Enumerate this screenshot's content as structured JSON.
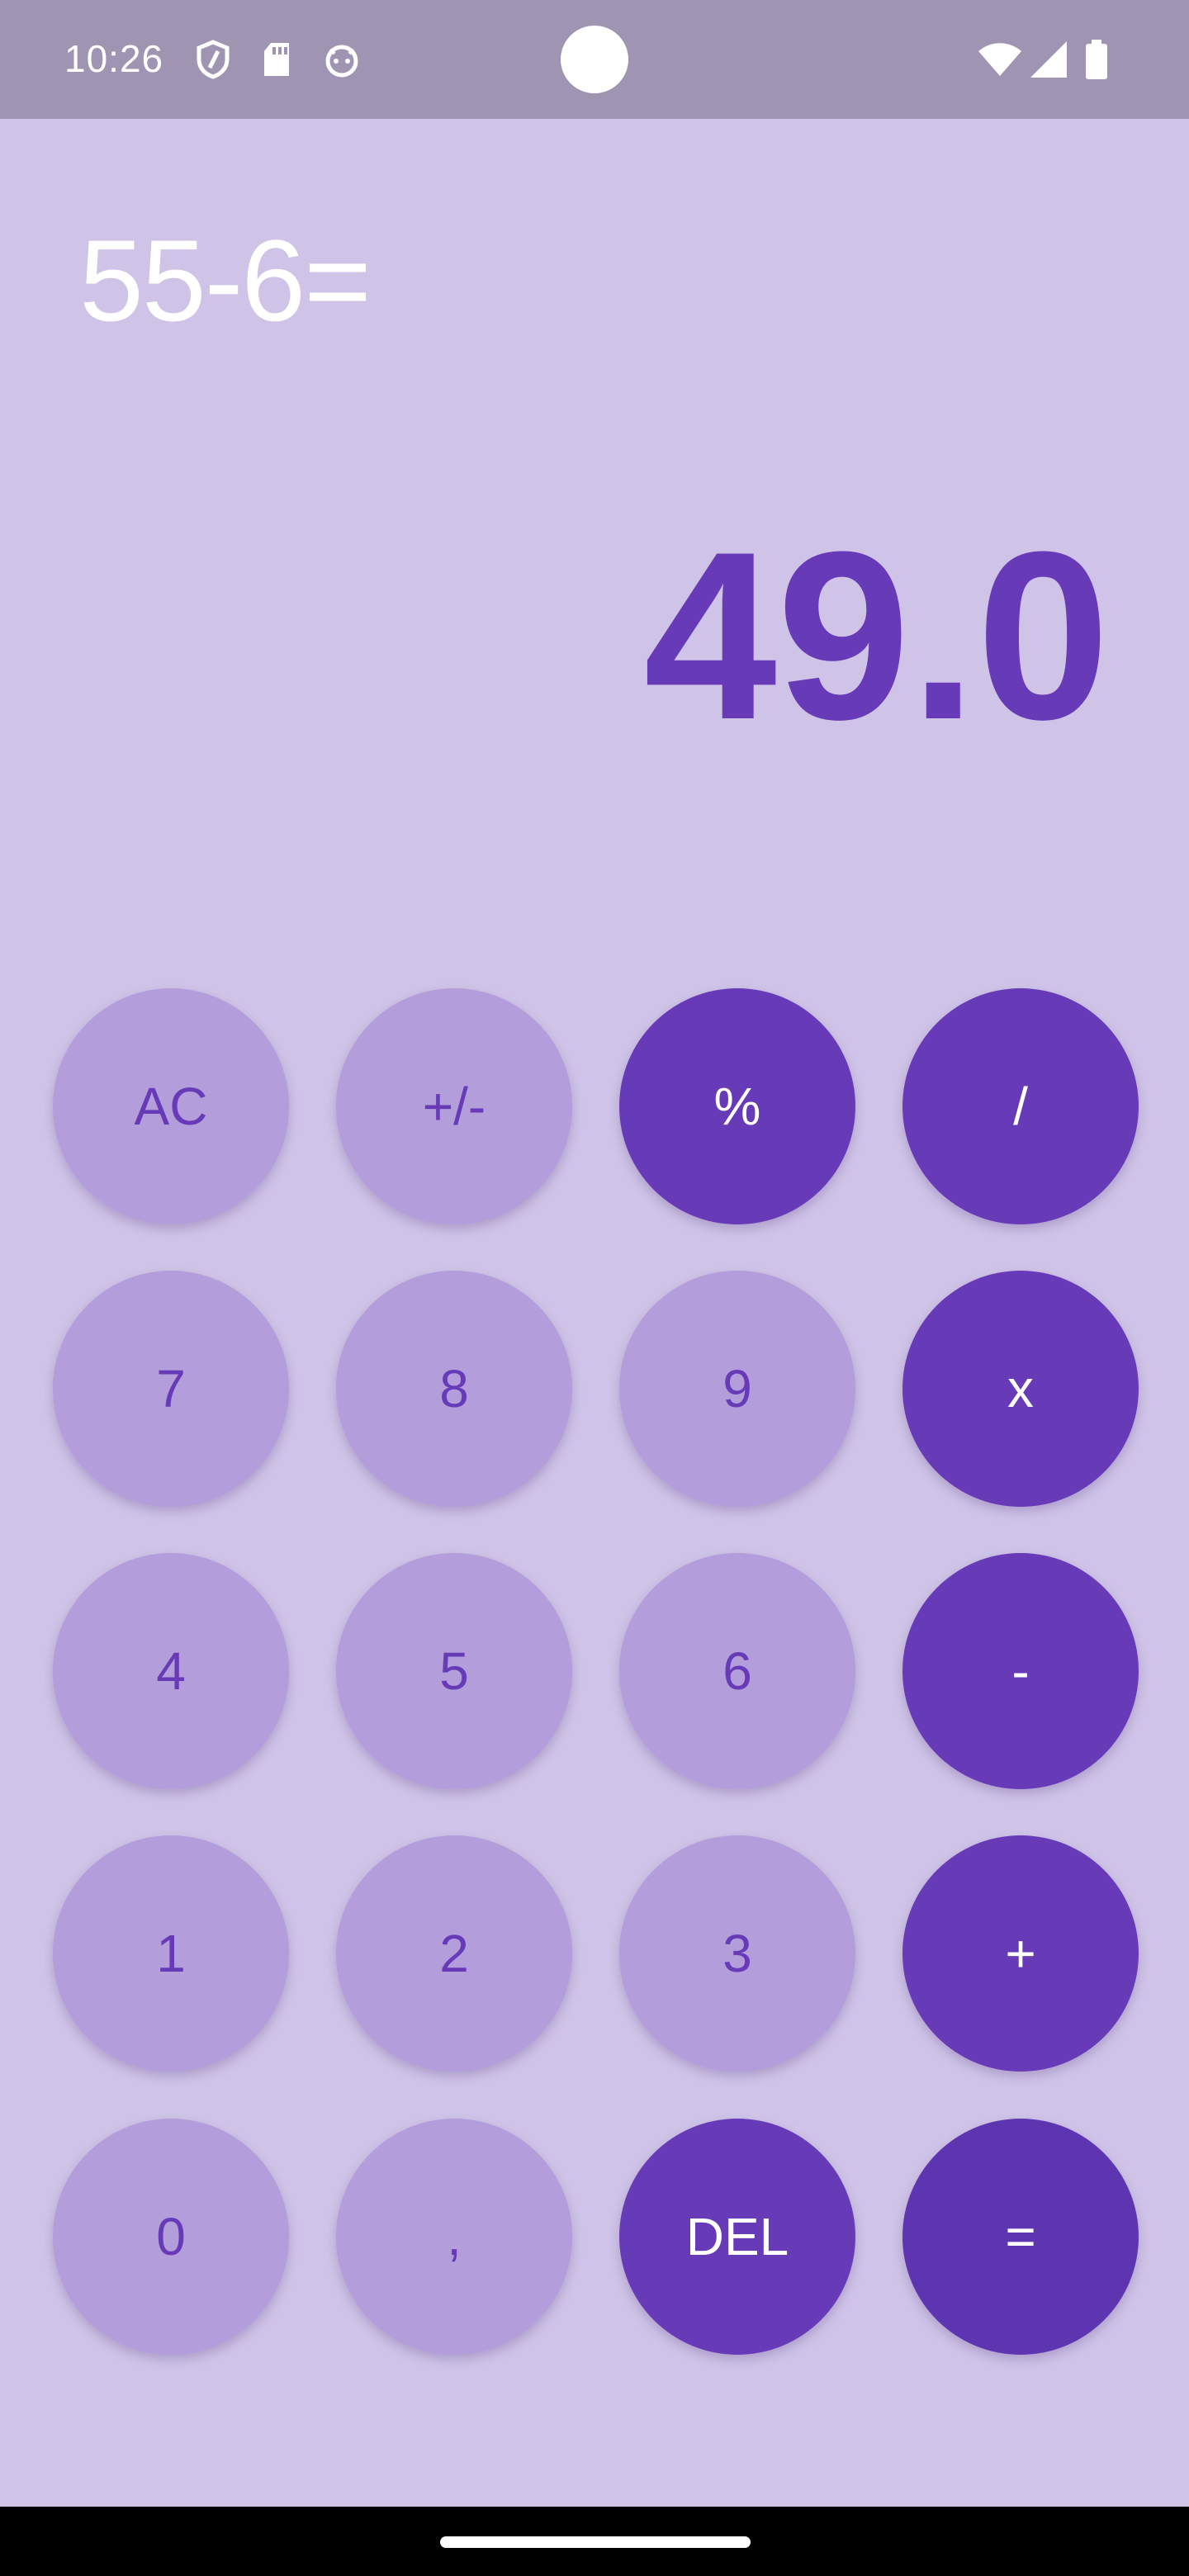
{
  "status_bar": {
    "time": "10:26",
    "left_icons": [
      "shield-icon",
      "sd-card-icon",
      "android-face-icon"
    ],
    "right_icons": [
      "wifi-icon",
      "signal-icon",
      "battery-icon"
    ]
  },
  "display": {
    "expression": "55-6=",
    "result": "49.0"
  },
  "keys": [
    {
      "label": "AC",
      "name": "clear-button",
      "style": "light"
    },
    {
      "label": "+/-",
      "name": "sign-toggle-button",
      "style": "light"
    },
    {
      "label": "%",
      "name": "percent-button",
      "style": "dark"
    },
    {
      "label": "/",
      "name": "divide-button",
      "style": "dark"
    },
    {
      "label": "7",
      "name": "digit-7-button",
      "style": "light"
    },
    {
      "label": "8",
      "name": "digit-8-button",
      "style": "light"
    },
    {
      "label": "9",
      "name": "digit-9-button",
      "style": "light"
    },
    {
      "label": "x",
      "name": "multiply-button",
      "style": "dark"
    },
    {
      "label": "4",
      "name": "digit-4-button",
      "style": "light"
    },
    {
      "label": "5",
      "name": "digit-5-button",
      "style": "light"
    },
    {
      "label": "6",
      "name": "digit-6-button",
      "style": "light"
    },
    {
      "label": "-",
      "name": "subtract-button",
      "style": "dark"
    },
    {
      "label": "1",
      "name": "digit-1-button",
      "style": "light"
    },
    {
      "label": "2",
      "name": "digit-2-button",
      "style": "light"
    },
    {
      "label": "3",
      "name": "digit-3-button",
      "style": "light"
    },
    {
      "label": "+",
      "name": "add-button",
      "style": "dark"
    },
    {
      "label": "0",
      "name": "digit-0-button",
      "style": "light"
    },
    {
      "label": ",",
      "name": "decimal-button",
      "style": "light"
    },
    {
      "label": "DEL",
      "name": "delete-button",
      "style": "dark"
    },
    {
      "label": "=",
      "name": "equals-button",
      "style": "dark"
    }
  ],
  "colors": {
    "background": "#cfc3e7",
    "key_light": "#b39ddb",
    "key_dark": "#673ab7",
    "accent_text": "#673ab7",
    "status_bar": "#9f95b2"
  }
}
